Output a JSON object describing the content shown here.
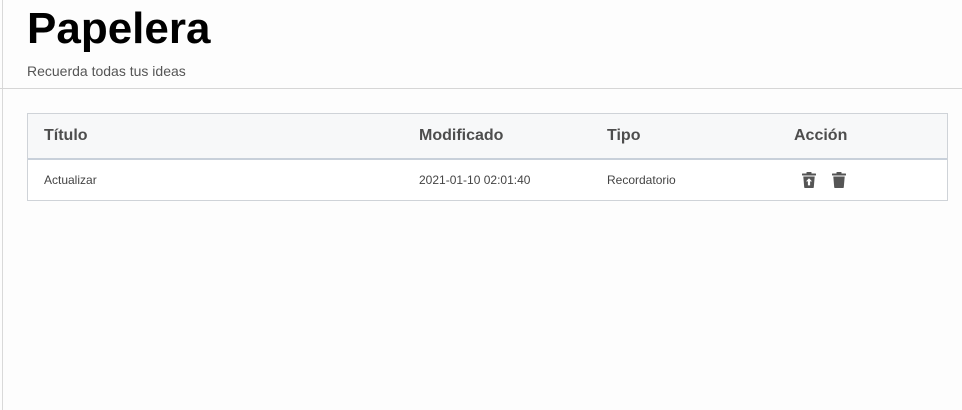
{
  "header": {
    "title": "Papelera",
    "subtitle": "Recuerda todas tus ideas"
  },
  "table": {
    "columns": {
      "title": "Título",
      "modified": "Modificado",
      "type": "Tipo",
      "action": "Acción"
    },
    "rows": [
      {
        "title": "Actualizar",
        "modified": "2021-01-10 02:01:40",
        "type": "Recordatorio",
        "actions": [
          "restore-icon",
          "trash-icon"
        ]
      }
    ]
  },
  "colors": {
    "icon": "#555555",
    "header_bg": "#f7f8f9",
    "border": "#cfd3d8"
  }
}
